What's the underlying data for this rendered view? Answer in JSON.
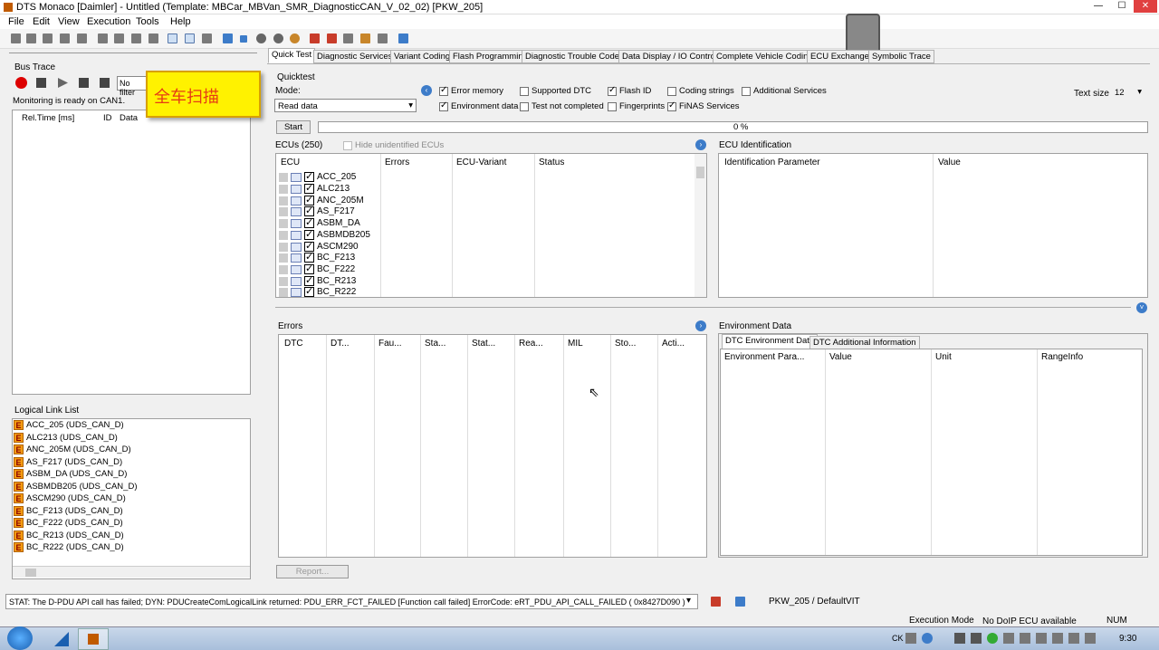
{
  "window": {
    "title": "DTS Monaco [Daimler] - Untitled (Template: MBCar_MBVan_SMR_DiagnosticCAN_V_02_02) [PKW_205]",
    "min": "—",
    "max": "☐",
    "close": "✕"
  },
  "menu": [
    "File",
    "Edit",
    "View",
    "Execution",
    "Tools",
    "Help"
  ],
  "bus_trace": {
    "title": "Bus Trace",
    "filter": "No filter",
    "status": "Monitoring is ready on CAN1.",
    "columns": [
      "Rel.Time [ms]",
      "ID",
      "Data"
    ]
  },
  "callout": "全车扫描",
  "logical_link": {
    "title": "Logical Link List",
    "items": [
      "ACC_205 (UDS_CAN_D)",
      "ALC213 (UDS_CAN_D)",
      "ANC_205M (UDS_CAN_D)",
      "AS_F217 (UDS_CAN_D)",
      "ASBM_DA (UDS_CAN_D)",
      "ASBMDB205 (UDS_CAN_D)",
      "ASCM290 (UDS_CAN_D)",
      "BC_F213 (UDS_CAN_D)",
      "BC_F222 (UDS_CAN_D)",
      "BC_R213 (UDS_CAN_D)",
      "BC_R222 (UDS_CAN_D)"
    ]
  },
  "tabs": [
    "Quick Test",
    "Diagnostic Services",
    "Variant Coding",
    "Flash Programming",
    "Diagnostic Trouble Codes",
    "Data Display / IO Control",
    "Complete Vehicle Coding",
    "ECU Exchange",
    "Symbolic Trace"
  ],
  "quicktest": {
    "title": "Quicktest",
    "mode_label": "Mode:",
    "mode_value": "Read data",
    "options": [
      {
        "label": "Error memory",
        "checked": true
      },
      {
        "label": "Supported DTC",
        "checked": false
      },
      {
        "label": "Flash ID",
        "checked": true
      },
      {
        "label": "Coding strings",
        "checked": false
      },
      {
        "label": "Additional Services",
        "checked": false
      },
      {
        "label": "Environment data",
        "checked": true
      },
      {
        "label": "Test not completed",
        "checked": false
      },
      {
        "label": "Fingerprints",
        "checked": false
      },
      {
        "label": "FiNAS Services",
        "checked": true
      }
    ],
    "text_size_label": "Text size",
    "text_size": "12",
    "start": "Start",
    "progress": "0 %",
    "progress_value": 0
  },
  "ecus": {
    "title": "ECUs (250)",
    "hide_label": "Hide unidentified ECUs",
    "columns": [
      "ECU",
      "Errors",
      "ECU-Variant",
      "Status"
    ],
    "items": [
      "ACC_205",
      "ALC213",
      "ANC_205M",
      "AS_F217",
      "ASBM_DA",
      "ASBMDB205",
      "ASCM290",
      "BC_F213",
      "BC_F222",
      "BC_R213",
      "BC_R222"
    ]
  },
  "ecu_ident": {
    "title": "ECU Identification",
    "columns": [
      "Identification Parameter",
      "Value"
    ]
  },
  "errors": {
    "title": "Errors",
    "columns": [
      "DTC",
      "DT...",
      "Fau...",
      "Sta...",
      "Stat...",
      "Rea...",
      "MIL",
      "Sto...",
      "Acti..."
    ]
  },
  "env": {
    "title": "Environment Data",
    "tabs": [
      "DTC Environment Data",
      "DTC Additional Information"
    ],
    "columns": [
      "Environment Para...",
      "Value",
      "Unit",
      "RangeInfo"
    ]
  },
  "report": "Report...",
  "status": {
    "message": "STAT: The D-PDU API call has failed; DYN: PDUCreateComLogicalLink returned: PDU_ERR_FCT_FAILED [Function call failed] ErrorCode: eRT_PDU_API_CALL_FAILED   ( 0x8427D090 )",
    "vit": "PKW_205 / DefaultVIT",
    "exec_label": "Execution Mode",
    "exec_value": "No DoIP ECU available",
    "num": "NUM"
  },
  "taskbar": {
    "time": "9:30",
    "lang": "CK"
  }
}
